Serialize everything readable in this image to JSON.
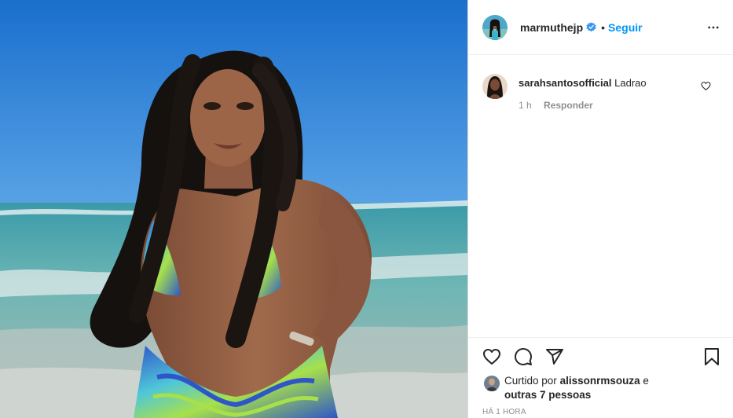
{
  "header": {
    "username": "marmuthejp",
    "separator": "•",
    "follow_label": "Seguir"
  },
  "comments": [
    {
      "username": "sarahsantosofficial",
      "text": "Ladrao",
      "time": "1 h",
      "reply_label": "Responder"
    }
  ],
  "likes": {
    "prefix": "Curtido por",
    "user": "alissonrmsouza",
    "conjunction": "e",
    "others": "outras 7 pessoas"
  },
  "timestamp": "HÁ 1 HORA",
  "icons": [
    "verified-badge-icon",
    "more-options-icon",
    "heart-icon",
    "comment-icon",
    "share-icon",
    "bookmark-icon"
  ],
  "colors": {
    "accent": "#0095f6",
    "text": "#262626",
    "muted": "#8e8e8e",
    "border": "#dbdbdb"
  }
}
